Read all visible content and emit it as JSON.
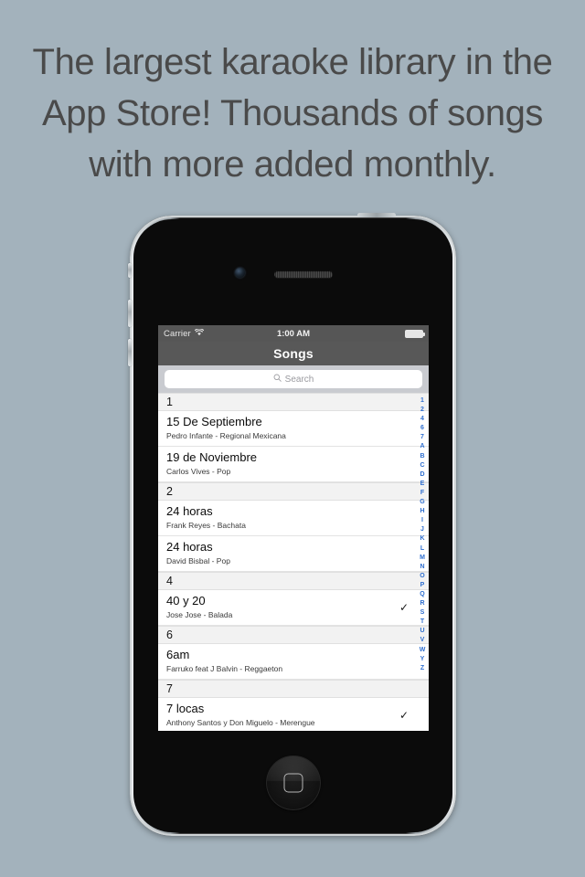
{
  "headline": {
    "lines": [
      "The largest karaoke library in the",
      "App Store! Thousands of songs",
      "with more added monthly."
    ],
    "text_color": "#4a4a4a"
  },
  "background_color": "#a3b2bc",
  "device": {
    "name": "iphone-4-black",
    "home_button": "home-button",
    "camera": "front-camera",
    "earpiece": "earpiece-speaker"
  },
  "screen": {
    "status_bar": {
      "carrier": "Carrier",
      "wifi_icon": "wifi-icon",
      "time": "1:00 AM",
      "battery_icon": "battery-full-icon",
      "background_color": "#565656"
    },
    "nav_bar": {
      "title": "Songs",
      "background_color": "#585858",
      "title_color": "#ffffff"
    },
    "search": {
      "placeholder": "Search",
      "icon": "search-icon",
      "bar_background": "#c9cbd0"
    },
    "list": {
      "sections": [
        {
          "header": "1",
          "rows": [
            {
              "title": "15 De Septiembre",
              "subtitle": "Pedro Infante - Regional Mexicana",
              "checked": false
            },
            {
              "title": "19 de Noviembre",
              "subtitle": "Carlos Vives - Pop",
              "checked": false
            }
          ]
        },
        {
          "header": "2",
          "rows": [
            {
              "title": "24 horas",
              "subtitle": "Frank Reyes - Bachata",
              "checked": false
            },
            {
              "title": "24 horas",
              "subtitle": "David Bisbal - Pop",
              "checked": false
            }
          ]
        },
        {
          "header": "4",
          "rows": [
            {
              "title": "40 y 20",
              "subtitle": "Jose Jose - Balada",
              "checked": true
            }
          ]
        },
        {
          "header": "6",
          "rows": [
            {
              "title": "6am",
              "subtitle": "Farruko feat J Balvin - Reggaeton",
              "checked": false
            }
          ]
        },
        {
          "header": "7",
          "rows": [
            {
              "title": "7 locas",
              "subtitle": "Anthony Santos y Don Miguelo - Merengue",
              "checked": true
            }
          ]
        }
      ],
      "check_glyph": "✓",
      "section_header_background": "#f2f2f2"
    },
    "index_bar": {
      "entries": [
        "1",
        "2",
        "4",
        "6",
        "7",
        "A",
        "B",
        "C",
        "D",
        "E",
        "F",
        "G",
        "H",
        "I",
        "J",
        "K",
        "L",
        "M",
        "N",
        "O",
        "P",
        "Q",
        "R",
        "S",
        "T",
        "U",
        "V",
        "W",
        "Y",
        "Z"
      ],
      "color": "#2f6fd0"
    }
  }
}
